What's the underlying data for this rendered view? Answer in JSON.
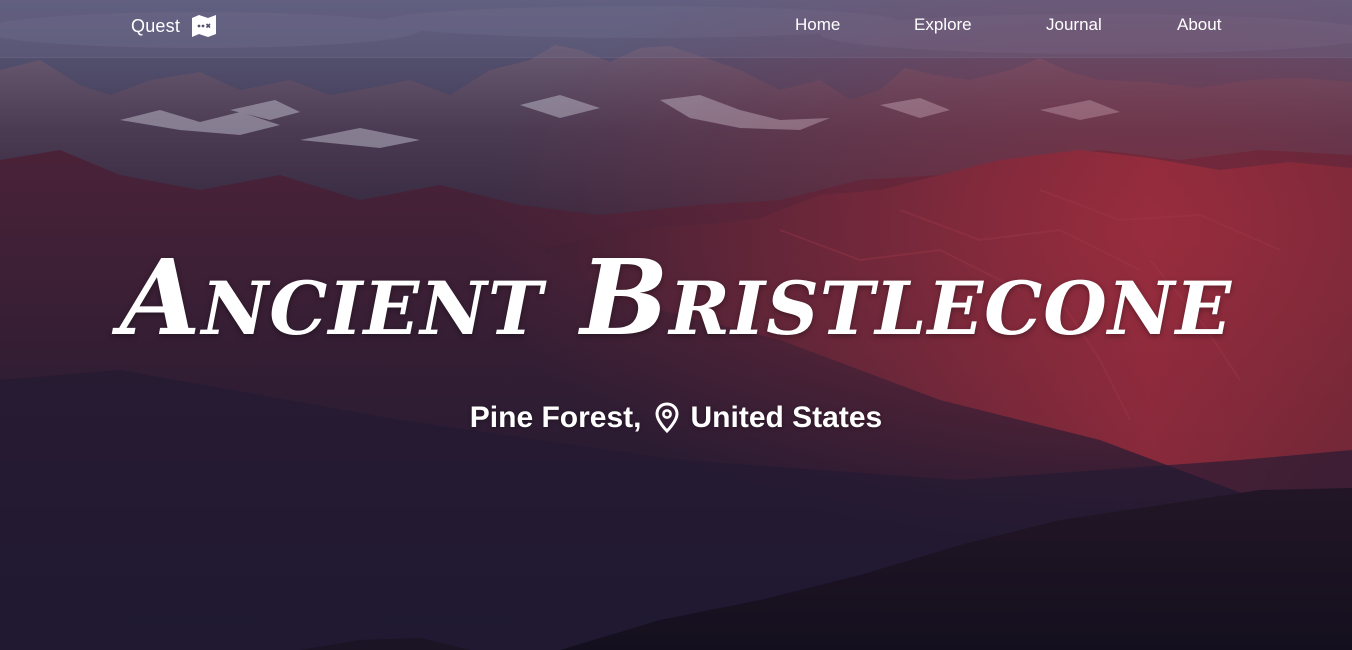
{
  "brand": {
    "name": "Quest",
    "icon": "map-icon"
  },
  "nav": {
    "items": [
      {
        "label": "Home"
      },
      {
        "label": "Explore"
      },
      {
        "label": "Journal"
      },
      {
        "label": "About"
      }
    ]
  },
  "hero": {
    "title": "Ancient Bristlecone",
    "location_prefix": "Pine Forest,",
    "location_icon": "location-pin-icon",
    "location_country": "United States",
    "background": "mountain-range-photo"
  },
  "colors": {
    "text": "#ffffff",
    "navbar_overlay": "#6e6c8c",
    "sky": "#5a5878",
    "mountain_red": "#8a2a3a",
    "shadow_dark": "#1e1a30"
  }
}
